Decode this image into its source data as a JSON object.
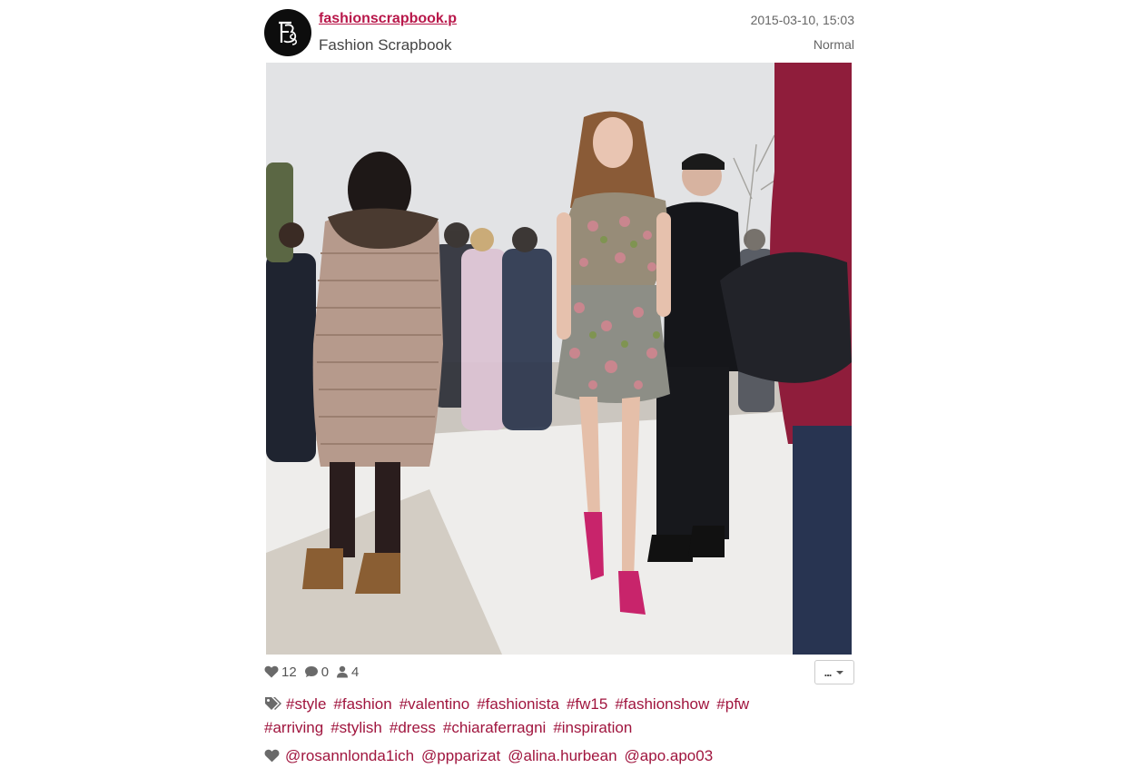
{
  "header": {
    "avatar_initials": "FBS",
    "username": "fashionscrapbook.p",
    "full_name": "Fashion Scrapbook",
    "timestamp": "2015-03-10, 15:03",
    "filter": "Normal"
  },
  "stats": {
    "likes": "12",
    "comments": "0",
    "users": "4"
  },
  "more_button": "...",
  "tags": [
    "#style",
    "#fashion",
    "#valentino",
    "#fashionista",
    "#fw15",
    "#fashionshow",
    "#pfw",
    "#arriving",
    "#stylish",
    "#dress",
    "#chiaraferragni",
    "#inspiration"
  ],
  "likers": [
    "@rosannlonda1ich",
    "@ppparizat",
    "@alina.hurbean",
    "@apo.apo03"
  ],
  "colors": {
    "link": "#b8174a",
    "tag": "#a0153e",
    "icon": "#666666"
  }
}
